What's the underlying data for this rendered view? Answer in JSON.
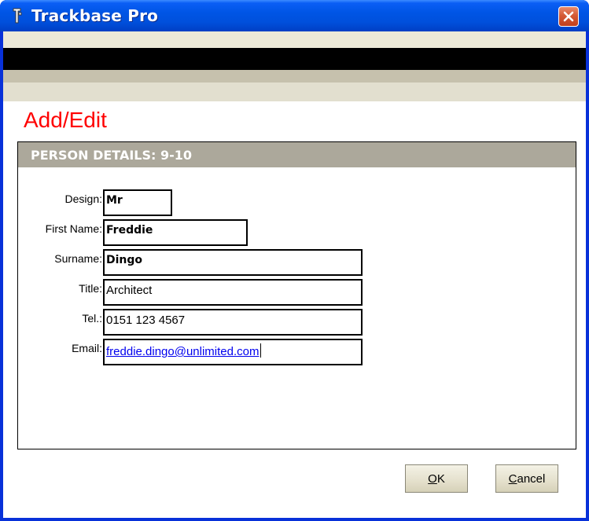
{
  "window": {
    "title": "Trackbase Pro"
  },
  "colors": {
    "heading": "#ff0000",
    "panel_header": "#aca89b",
    "titlebar": "#0055e5"
  },
  "page": {
    "heading": "Add/Edit"
  },
  "panel": {
    "header": "PERSON DETAILS:  9-10"
  },
  "form": {
    "design": {
      "label": "Design:",
      "value": "Mr"
    },
    "first_name": {
      "label": "First Name:",
      "value": "Freddie"
    },
    "surname": {
      "label": "Surname:",
      "value": "Dingo"
    },
    "title": {
      "label": "Title:",
      "value": "Architect"
    },
    "tel": {
      "label": "Tel.:",
      "value": "0151 123 4567"
    },
    "email": {
      "label": "Email:",
      "value": "freddie.dingo@unlimited.com"
    }
  },
  "buttons": {
    "ok": {
      "mnemonic": "O",
      "rest": "K"
    },
    "cancel": {
      "mnemonic": "C",
      "rest": "ancel"
    }
  },
  "icons": {
    "app": "trackbase-app-icon",
    "close": "close-icon"
  }
}
